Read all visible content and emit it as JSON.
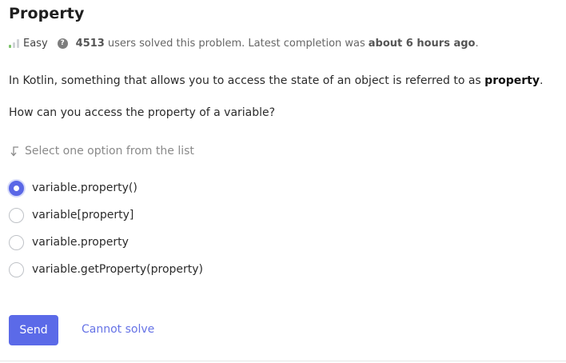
{
  "problem": {
    "title": "Property",
    "difficulty": "Easy",
    "solved_count": "4513",
    "solved_text": "users solved this problem. Latest completion was",
    "latest_time": "about 6 hours ago",
    "latest_suffix": "."
  },
  "statement": {
    "text": "In Kotlin, something that allows you to access the state of an object is referred to as ",
    "bold": "property",
    "suffix": "."
  },
  "question": "How can you access the property of a variable?",
  "hint": "Select one option from the list",
  "options": [
    {
      "label": "variable.property()",
      "selected": true
    },
    {
      "label": "variable[property]",
      "selected": false
    },
    {
      "label": "variable.property",
      "selected": false
    },
    {
      "label": "variable.getProperty(property)",
      "selected": false
    }
  ],
  "actions": {
    "send_label": "Send",
    "cannot_solve_label": "Cannot solve"
  },
  "colors": {
    "accent": "#5b6ae8",
    "difficulty_easy": "#7cc36a"
  },
  "icons": {
    "difficulty": "signal-bars-icon",
    "help": "question-circle-icon",
    "hint": "arrow-down-left-icon"
  }
}
